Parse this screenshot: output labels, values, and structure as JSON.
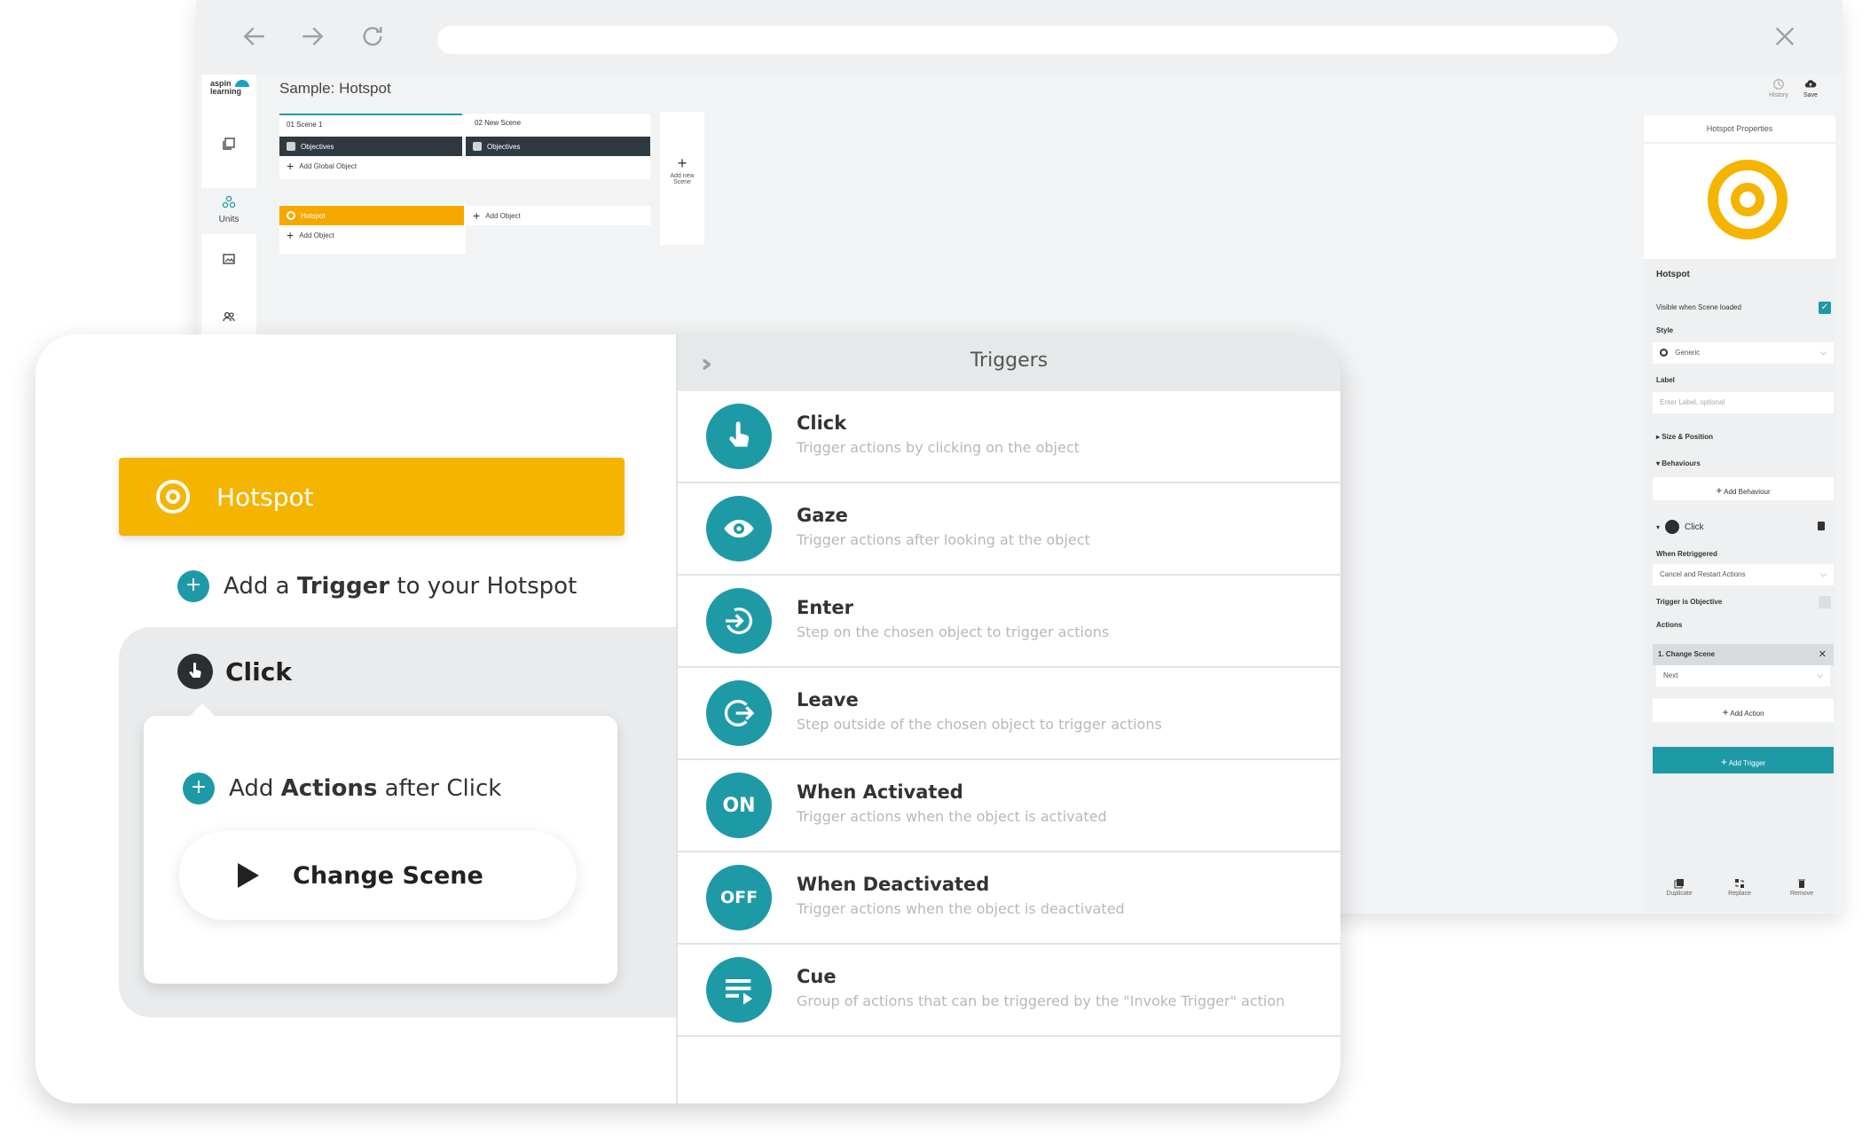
{
  "browser": {
    "back_icon": "arrow-left-icon",
    "forward_icon": "arrow-right-icon",
    "reload_icon": "reload-icon",
    "close_icon": "close-icon"
  },
  "app": {
    "logo_line1": "aspin",
    "logo_line2": "learning",
    "title": "Sample: Hotspot",
    "sidebar": {
      "units_label": "Units"
    },
    "toolbar": {
      "history_label": "History",
      "save_label": "Save"
    },
    "scenes": {
      "scene1_tab": "01  Scene 1",
      "scene2_tab": "02  New Scene",
      "objectives_label_1": "Objectives",
      "objectives_label_2": "Objectives",
      "add_global_object": "Add Global Object",
      "hotspot_label": "Hotspot",
      "add_object_1": "Add Object",
      "add_object_2": "Add Object",
      "add_new_scene_1": "Add new",
      "add_new_scene_2": "Scene"
    }
  },
  "properties": {
    "header": "Hotspot Properties",
    "name": "Hotspot",
    "visible_label": "Visible when Scene loaded",
    "visible_checked": true,
    "style_label": "Style",
    "style_value": "Generic",
    "label_label": "Label",
    "label_placeholder": "Enter Label, optional",
    "size_position": "Size & Position",
    "behaviours": "Behaviours",
    "add_behaviour": "Add Behaviour",
    "trigger_name": "Click",
    "when_retriggered_label": "When Retriggered",
    "when_retriggered_value": "Cancel and Restart Actions",
    "trigger_objective_label": "Trigger is Objective",
    "actions_label": "Actions",
    "action_1": "1. Change Scene",
    "action_1_value": "Next",
    "add_action": "Add Action",
    "add_trigger": "Add Trigger",
    "duplicate": "Duplicate",
    "replace": "Replace",
    "remove": "Remove"
  },
  "card": {
    "hotspot_title": "Hotspot",
    "add_trigger_prefix": "Add a",
    "add_trigger_bold": "Trigger",
    "add_trigger_suffix": "to your Hotspot",
    "click_title": "Click",
    "add_actions_prefix": "Add",
    "add_actions_bold": "Actions",
    "add_actions_suffix": "after Click",
    "change_scene": "Change Scene"
  },
  "triggers": {
    "title": "Triggers",
    "items": [
      {
        "name": "Click",
        "desc": "Trigger actions by clicking on the object",
        "icon": "hand-pointer-icon",
        "badge": ""
      },
      {
        "name": "Gaze",
        "desc": "Trigger actions after looking at the object",
        "icon": "eye-icon",
        "badge": ""
      },
      {
        "name": "Enter",
        "desc": "Step on the chosen object to trigger actions",
        "icon": "enter-icon",
        "badge": ""
      },
      {
        "name": "Leave",
        "desc": "Step outside of the chosen object to trigger actions",
        "icon": "leave-icon",
        "badge": ""
      },
      {
        "name": "When Activated",
        "desc": "Trigger actions when the object is activated",
        "icon": "on-badge-icon",
        "badge": "ON"
      },
      {
        "name": "When Deactivated",
        "desc": "Trigger actions when the object is deactivated",
        "icon": "off-badge-icon",
        "badge": "OFF"
      },
      {
        "name": "Cue",
        "desc": "Group of actions that can be triggered by the \"Invoke Trigger\" action",
        "icon": "cue-list-icon",
        "badge": ""
      }
    ]
  },
  "colors": {
    "accent": "#1e9aa7",
    "hotspot": "#f5b400"
  }
}
